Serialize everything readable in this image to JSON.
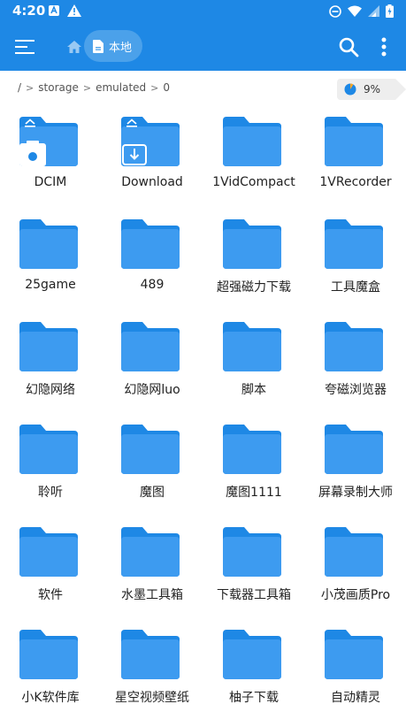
{
  "status_bar": {
    "time": "4:20",
    "icons": [
      "notification-a-icon",
      "warning-icon",
      "do-not-disturb-icon",
      "wifi-icon",
      "signal-icon",
      "battery-charging-icon"
    ]
  },
  "app_bar": {
    "menu_icon": "hamburger-menu-icon",
    "home_icon": "home-icon",
    "location_chip": "本地",
    "search_icon": "search-icon",
    "more_icon": "more-vertical-icon",
    "color": "#1e88e5"
  },
  "path": {
    "crumbs": [
      "/",
      "storage",
      "emulated",
      "0"
    ],
    "storage_usage": "9%",
    "storage_fraction": 0.09
  },
  "folders": [
    {
      "name": "DCIM",
      "badge": "camera"
    },
    {
      "name": "Download",
      "badge": "download"
    },
    {
      "name": "1VidCompact"
    },
    {
      "name": "1VRecorder"
    },
    {
      "name": "25game"
    },
    {
      "name": "489"
    },
    {
      "name": "超强磁力下载"
    },
    {
      "name": "工具魔盒"
    },
    {
      "name": "幻隐网络"
    },
    {
      "name": "幻隐网luo"
    },
    {
      "name": "脚本"
    },
    {
      "name": "夸磁浏览器"
    },
    {
      "name": "聆听"
    },
    {
      "name": "魔图"
    },
    {
      "name": "魔图1111"
    },
    {
      "name": "屏幕录制大师"
    },
    {
      "name": "软件"
    },
    {
      "name": "水墨工具箱"
    },
    {
      "name": "下载器工具箱"
    },
    {
      "name": "小茂画质Pro"
    },
    {
      "name": "小K软件库"
    },
    {
      "name": "星空视频壁纸"
    },
    {
      "name": "柚子下载"
    },
    {
      "name": "自动精灵"
    }
  ]
}
